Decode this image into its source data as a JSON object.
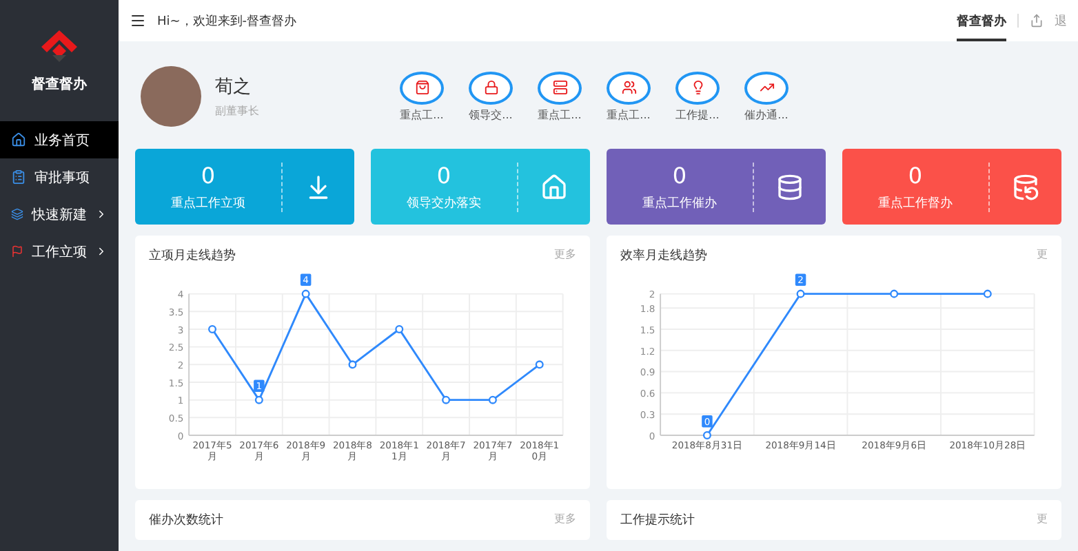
{
  "sidebar": {
    "logo_text": "督查督办",
    "items": [
      {
        "label": "业务首页",
        "selected": true,
        "kind": "home",
        "expandable": false
      },
      {
        "label": "审批事项",
        "selected": false,
        "kind": "approve",
        "expandable": false
      },
      {
        "label": "快速新建",
        "selected": false,
        "kind": "layers",
        "expandable": true
      },
      {
        "label": "工作立项",
        "selected": false,
        "kind": "flag",
        "expandable": true
      }
    ]
  },
  "header": {
    "greeting": "Hi~，欢迎来到-督查督办",
    "tabs": [
      {
        "label": "督查督办",
        "selected": true
      }
    ],
    "logout": "退"
  },
  "profile": {
    "name": "荀之",
    "role": "副董事长"
  },
  "shortcuts": [
    {
      "label": "重点工...",
      "kind": "bag"
    },
    {
      "label": "领导交...",
      "kind": "lock"
    },
    {
      "label": "重点工...",
      "kind": "server"
    },
    {
      "label": "重点工...",
      "kind": "people"
    },
    {
      "label": "工作提...",
      "kind": "bulb"
    },
    {
      "label": "催办通...",
      "kind": "trend"
    }
  ],
  "stats": [
    {
      "value": "0",
      "label": "重点工作立项",
      "color": "#0aa6d8",
      "kind": "download"
    },
    {
      "value": "0",
      "label": "领导交办落实",
      "color": "#23c2de",
      "kind": "house"
    },
    {
      "value": "0",
      "label": "重点工作催办",
      "color": "#7160b8",
      "kind": "stack"
    },
    {
      "value": "0",
      "label": "重点工作督办",
      "color": "#fb5149",
      "kind": "stack-off"
    }
  ],
  "charts": [
    {
      "title": "立项月走线趋势",
      "more": "更多",
      "chart_data": {
        "type": "line",
        "categories": [
          "2017年5月",
          "2017年6月",
          "2018年9月",
          "2018年8月",
          "2018年11月",
          "2018年7月",
          "2017年7月",
          "2018年10月"
        ],
        "series": [
          {
            "color": "#2f89fc",
            "marker": true,
            "values": [
              3,
              1,
              4,
              2,
              3,
              1,
              1,
              2
            ]
          }
        ],
        "grid": true,
        "ylim": [
          0,
          4
        ],
        "yticks": [
          0,
          0.5,
          1,
          1.5,
          2,
          2.5,
          3,
          3.5,
          4
        ],
        "annotations": [
          {
            "x": "2018年9月",
            "y": 4,
            "text": "4"
          },
          {
            "x": "2017年6月",
            "y": 1,
            "text": "1"
          }
        ]
      }
    },
    {
      "title": "效率月走线趋势",
      "more": "更",
      "chart_data": {
        "type": "line",
        "categories": [
          "2018年8月31日",
          "2018年9月14日",
          "2018年9月6日",
          "2018年10月28日"
        ],
        "series": [
          {
            "color": "#2f89fc",
            "marker": true,
            "values": [
              0,
              2,
              2,
              2
            ]
          }
        ],
        "grid": true,
        "ylim": [
          0,
          2
        ],
        "yticks": [
          0,
          0.3,
          0.6,
          0.9,
          1.2,
          1.5,
          1.8,
          2
        ],
        "annotations": [
          {
            "x": "2018年9月14日",
            "y": 2,
            "text": "2"
          },
          {
            "x": "2018年8月31日",
            "y": 0,
            "text": "0"
          }
        ]
      }
    }
  ],
  "bottom_cards": [
    {
      "title": "催办次数统计",
      "more": "更多"
    },
    {
      "title": "工作提示统计",
      "more": "更"
    }
  ]
}
